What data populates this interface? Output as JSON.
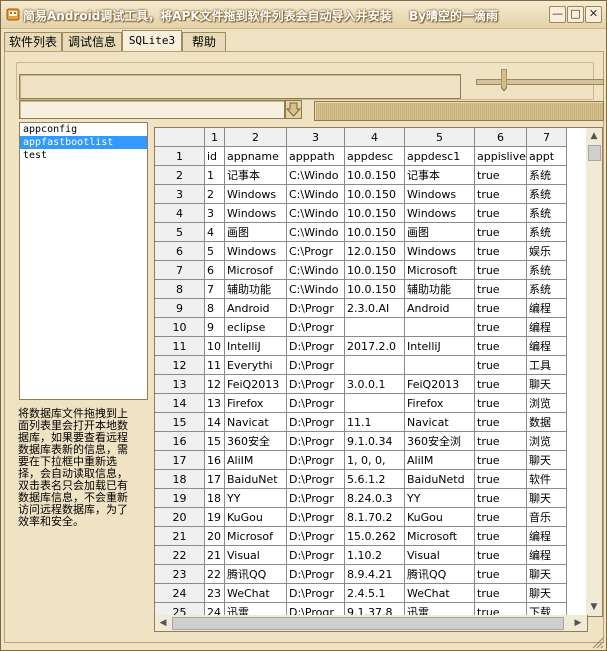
{
  "title": "简易Android调试工具，将APK文件拖到软件列表会自动导入并安装",
  "author": "By晴空的一滴雨",
  "window_buttons": {
    "minimize": "—",
    "maximize": "□",
    "close": "✕"
  },
  "tabs": [
    {
      "label": "软件列表"
    },
    {
      "label": "调试信息"
    },
    {
      "label": "SQLite3"
    },
    {
      "label": "帮助"
    }
  ],
  "tables": [
    "appconfig",
    "appfastbootlist",
    "test"
  ],
  "selected_table": "appfastbootlist",
  "notes": [
    "将数据库文件拖拽到上",
    "面列表里会打开本地数",
    "据库，如果要查看远程",
    "数据库表新的信息，需",
    "要在下拉框中重新选",
    "择，会自动读取信息，",
    "双击表名只会加载已有",
    "数据库信息，不会重新",
    "访问远程数据库，为了",
    "效率和安全。"
  ],
  "grid": {
    "col_headers": [
      "1",
      "2",
      "3",
      "4",
      "5",
      "6",
      "7"
    ],
    "rows": [
      {
        "num": "1",
        "cells": [
          "id",
          "appname",
          "apppath",
          "appdesc",
          "appdesc1",
          "appislive",
          "appt"
        ]
      },
      {
        "num": "2",
        "cells": [
          "1",
          "记事本",
          "C:\\Windo",
          "10.0.150",
          "记事本",
          "true",
          "系统"
        ]
      },
      {
        "num": "3",
        "cells": [
          "2",
          "Windows",
          "C:\\Windo",
          "10.0.150",
          "Windows",
          "true",
          "系统"
        ]
      },
      {
        "num": "4",
        "cells": [
          "3",
          "Windows",
          "C:\\Windo",
          "10.0.150",
          "Windows",
          "true",
          "系统"
        ]
      },
      {
        "num": "5",
        "cells": [
          "4",
          "画图",
          "C:\\Windo",
          "10.0.150",
          "画图",
          "true",
          "系统"
        ]
      },
      {
        "num": "6",
        "cells": [
          "5",
          "Windows",
          "C:\\Progr",
          "12.0.150",
          "Windows",
          "true",
          "娱乐"
        ]
      },
      {
        "num": "7",
        "cells": [
          "6",
          "Microsof",
          "C:\\Windo",
          "10.0.150",
          "Microsoft",
          "true",
          "系统"
        ]
      },
      {
        "num": "8",
        "cells": [
          "7",
          "辅助功能",
          "C:\\Windo",
          "10.0.150",
          "辅助功能",
          "true",
          "系统"
        ]
      },
      {
        "num": "9",
        "cells": [
          "8",
          "Android",
          "D:\\Progr",
          "2.3.0.AI",
          "Android",
          "true",
          "编程"
        ]
      },
      {
        "num": "10",
        "cells": [
          "9",
          "eclipse",
          "D:\\Progr",
          "",
          "",
          "true",
          "编程"
        ]
      },
      {
        "num": "11",
        "cells": [
          "10",
          "IntelliJ",
          "D:\\Progr",
          "2017.2.0",
          "IntelliJ",
          "true",
          "编程"
        ]
      },
      {
        "num": "12",
        "cells": [
          "11",
          "Everythi",
          "D:\\Progr",
          "",
          "",
          "true",
          "工具"
        ]
      },
      {
        "num": "13",
        "cells": [
          "12",
          "FeiQ2013",
          "D:\\Progr",
          "3.0.0.1",
          "FeiQ2013",
          "true",
          "聊天"
        ]
      },
      {
        "num": "14",
        "cells": [
          "13",
          "Firefox",
          "D:\\Progr",
          "",
          "Firefox",
          "true",
          "浏览"
        ]
      },
      {
        "num": "15",
        "cells": [
          "14",
          "Navicat",
          "D:\\Progr",
          "11.1",
          "Navicat",
          "true",
          "数据"
        ]
      },
      {
        "num": "16",
        "cells": [
          "15",
          "360安全",
          "D:\\Progr",
          "9.1.0.34",
          "360安全浏",
          "true",
          "浏览"
        ]
      },
      {
        "num": "17",
        "cells": [
          "16",
          "AliIM",
          "D:\\Progr",
          "1, 0, 0,",
          "AliIM",
          "true",
          "聊天"
        ]
      },
      {
        "num": "18",
        "cells": [
          "17",
          "BaiduNet",
          "D:\\Progr",
          "5.6.1.2",
          "BaiduNetd",
          "true",
          "软件"
        ]
      },
      {
        "num": "19",
        "cells": [
          "18",
          "YY",
          "D:\\Progr",
          "8.24.0.3",
          "YY",
          "true",
          "聊天"
        ]
      },
      {
        "num": "20",
        "cells": [
          "19",
          "KuGou",
          "D:\\Progr",
          "8.1.70.2",
          "KuGou",
          "true",
          "音乐"
        ]
      },
      {
        "num": "21",
        "cells": [
          "20",
          "Microsof",
          "D:\\Progr",
          "15.0.262",
          "Microsoft",
          "true",
          "编程"
        ]
      },
      {
        "num": "22",
        "cells": [
          "21",
          "Visual",
          "D:\\Progr",
          "1.10.2",
          "Visual",
          "true",
          "编程"
        ]
      },
      {
        "num": "23",
        "cells": [
          "22",
          "腾讯QQ",
          "D:\\Progr",
          "8.9.4.21",
          "腾讯QQ",
          "true",
          "聊天"
        ]
      },
      {
        "num": "24",
        "cells": [
          "23",
          "WeChat",
          "D:\\Progr",
          "2.4.5.1",
          "WeChat",
          "true",
          "聊天"
        ]
      },
      {
        "num": "25",
        "cells": [
          "24",
          "迅雷",
          "D:\\Progr",
          "9.1.37.8",
          "迅雷",
          "true",
          "下载"
        ]
      }
    ]
  },
  "colors": {
    "selection": "#3399ff",
    "background": "#efe3c4"
  },
  "icons": {
    "app": "android-icon",
    "dropdown": "down-arrow-icon",
    "slider": "slider-thumb-icon"
  }
}
